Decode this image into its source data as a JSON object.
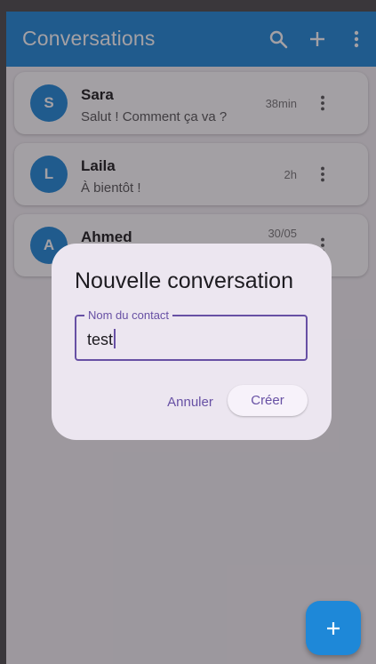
{
  "appbar": {
    "title": "Conversations",
    "actions": [
      "search-icon",
      "add-icon",
      "more-vert-icon"
    ]
  },
  "conversations": [
    {
      "initial": "S",
      "name": "Sara",
      "preview": "Salut ! Comment ça va ?",
      "time": "38min"
    },
    {
      "initial": "L",
      "name": "Laila",
      "preview": "À bientôt !",
      "time": "2h"
    },
    {
      "initial": "A",
      "name": "Ahmed",
      "preview": "",
      "time": "30/05"
    }
  ],
  "dialog": {
    "title": "Nouvelle conversation",
    "field_label": "Nom du contact",
    "field_value": "test",
    "cancel_label": "Annuler",
    "create_label": "Créer"
  },
  "fab": {
    "icon": "add-icon"
  },
  "colors": {
    "primary": "#1e88d8",
    "dialog_bg": "#ece6f0",
    "accent": "#6750a4"
  }
}
